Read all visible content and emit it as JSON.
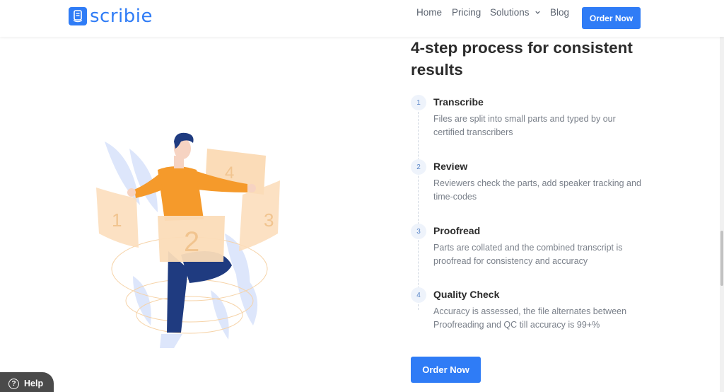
{
  "header": {
    "logo_text": "scribie",
    "nav": {
      "home": "Home",
      "pricing": "Pricing",
      "solutions": "Solutions",
      "blog": "Blog"
    },
    "order_button": "Order Now"
  },
  "main": {
    "heading_line1": "4-step process for consistent",
    "heading_line2": "results",
    "steps": [
      {
        "num": "1",
        "title": "Transcribe",
        "desc": "Files are split into small parts and typed by our certified transcribers"
      },
      {
        "num": "2",
        "title": "Review",
        "desc": "Reviewers check the parts, add speaker tracking and time-codes"
      },
      {
        "num": "3",
        "title": "Proofread",
        "desc": "Parts are collated and the combined transcript is proofread for consistency and accuracy"
      },
      {
        "num": "4",
        "title": "Quality Check",
        "desc": "Accuracy is assessed, the file alternates between Proofreading and QC till accuracy is 99+%"
      }
    ],
    "order_button": "Order Now"
  },
  "illustration": {
    "panel_labels": [
      "1",
      "2",
      "3",
      "4"
    ],
    "accent_color": "#f59a2b",
    "panel_color": "#fbdcb8",
    "pants_color": "#1f3b80",
    "leaf_color": "#dde6fb"
  },
  "help": {
    "icon": "question-circle-icon",
    "label": "Help"
  },
  "colors": {
    "brand": "#2f7cf6"
  }
}
